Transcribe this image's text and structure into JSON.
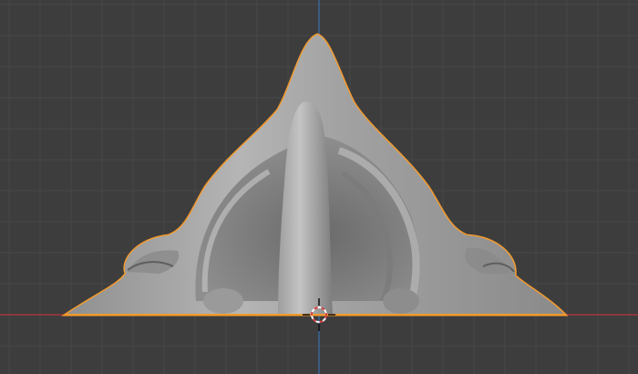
{
  "viewport": {
    "background_color": "#3d3d3d",
    "grid_minor_color": "#464646",
    "grid_major_color": "#4e4e4e",
    "x_axis_color": "#a3363d",
    "z_axis_color": "#3b6fb0"
  },
  "object": {
    "selected": true,
    "outline_color": "#f29a2e",
    "surface_color": "#a8a8a8",
    "shadow_color": "#6b6b6b",
    "highlight_color": "#c9c9c9"
  },
  "cursor_3d": {
    "icon": "crosshair-3d-cursor-icon",
    "ring_color_a": "#d94545",
    "ring_color_b": "#ffffff"
  }
}
